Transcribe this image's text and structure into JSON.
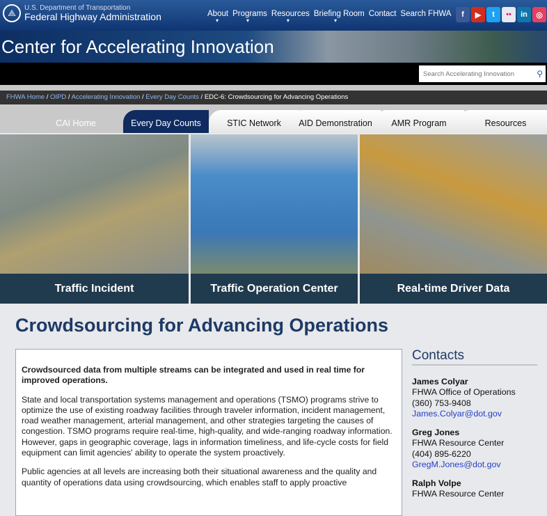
{
  "header": {
    "dot": "U.S. Department of Transportation",
    "agency": "Federal Highway Administration",
    "nav": [
      {
        "label": "About",
        "dropdown": true
      },
      {
        "label": "Programs",
        "dropdown": true
      },
      {
        "label": "Resources",
        "dropdown": true
      },
      {
        "label": "Briefing Room",
        "dropdown": true
      },
      {
        "label": "Contact",
        "dropdown": false
      },
      {
        "label": "Search FHWA",
        "dropdown": false
      }
    ],
    "social": [
      {
        "icon": "facebook-icon",
        "glyph": "f",
        "color": "#3b5998"
      },
      {
        "icon": "youtube-icon",
        "glyph": "▶",
        "color": "#d52b1e"
      },
      {
        "icon": "twitter-icon",
        "glyph": "t",
        "color": "#1da1f2"
      },
      {
        "icon": "flickr-icon",
        "glyph": "••",
        "color": "#e8e8f0"
      },
      {
        "icon": "linkedin-icon",
        "glyph": "in",
        "color": "#0e76a8"
      },
      {
        "icon": "instagram-icon",
        "glyph": "◎",
        "color": "#e4405f"
      }
    ]
  },
  "banner": {
    "title": "Center for Accelerating Innovation"
  },
  "search": {
    "placeholder": "Search Accelerating Innovation"
  },
  "breadcrumb": [
    {
      "label": "FHWA Home",
      "link": true
    },
    {
      "label": "OIPD",
      "link": true
    },
    {
      "label": "Accelerating Innovation",
      "link": true
    },
    {
      "label": "Every Day Counts",
      "link": true
    },
    {
      "label": "EDC-6: Crowdsourcing for Advancing Operations",
      "link": false
    }
  ],
  "tabs": [
    {
      "label": "CAI Home",
      "active": false
    },
    {
      "label": "Every Day Counts",
      "active": true
    },
    {
      "label": "STIC Network",
      "active": false
    },
    {
      "label": "AID Demonstration",
      "active": false
    },
    {
      "label": "AMR Program",
      "active": false
    },
    {
      "label": "Resources",
      "active": false
    }
  ],
  "panels": [
    {
      "caption": "Traffic Incident"
    },
    {
      "caption": "Traffic Operation Center"
    },
    {
      "caption": "Real-time Driver Data"
    }
  ],
  "page": {
    "title": "Crowdsourcing for Advancing Operations",
    "lead": "Crowdsourced data from multiple streams can be integrated and used in real time for improved operations.",
    "para1": "State and local transportation systems management and operations (TSMO) programs strive to optimize the use of existing roadway facilities through traveler information, incident management, road weather management, arterial management, and other strategies targeting the causes of congestion. TSMO programs require real-time, high-quality, and wide-ranging roadway information. However, gaps in geographic coverage, lags in information timeliness, and life-cycle costs for field equipment can limit agencies' ability to operate the system proactively.",
    "para2": "Public agencies at all levels are increasing both their situational awareness and the quality and quantity of operations data using crowdsourcing, which enables staff to apply proactive"
  },
  "contacts": {
    "heading": "Contacts",
    "people": [
      {
        "name": "James Colyar",
        "org": "FHWA Office of Operations",
        "phone": "(360) 753-9408",
        "email": "James.Colyar@dot.gov"
      },
      {
        "name": "Greg Jones",
        "org": "FHWA Resource Center",
        "phone": "(404) 895-6220",
        "email": "GregM.Jones@dot.gov"
      },
      {
        "name": "Ralph Volpe",
        "org": "FHWA Resource Center"
      }
    ]
  }
}
